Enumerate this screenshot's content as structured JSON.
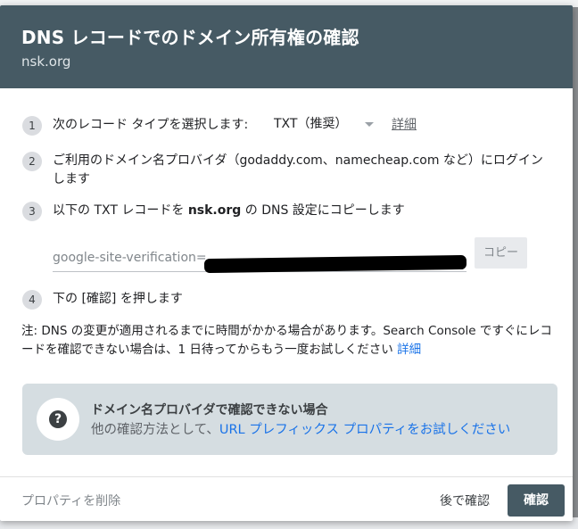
{
  "dialog": {
    "title": "DNS レコードでのドメイン所有権の確認",
    "subtitle": "nsk.org"
  },
  "steps": [
    {
      "number": "1",
      "text": "次のレコード タイプを選択します:"
    },
    {
      "number": "2",
      "text_line1": "ご利用のドメイン名プロバイダ（godaddy.com、namecheap.com など）にログイン",
      "text_line2": "します"
    },
    {
      "number": "3",
      "text_before": "以下の TXT レコードを ",
      "domain": "nsk.org",
      "text_after": " の DNS 設定にコピーします"
    },
    {
      "number": "4",
      "text": "下の [確認] を押します"
    }
  ],
  "record_type": {
    "selected": "TXT（推奨）",
    "details_link": "詳細"
  },
  "txt_record": {
    "value_prefix": "google-site-verification=",
    "copy_label": "コピー"
  },
  "note": {
    "text": "注: DNS の変更が適用されるまでに時間がかかる場合があります。Search Console ですぐにレコードを確認できない場合は、1 日待ってからもう一度お試しください",
    "link": "詳細"
  },
  "info": {
    "title": "ドメイン名プロバイダで確認できない場合",
    "body_prefix": "他の確認方法として、",
    "body_link": "URL プレフィックス プロパティをお試しください"
  },
  "footer": {
    "delete_label": "プロパティを削除",
    "later_label": "後で確認",
    "verify_label": "確認"
  },
  "colors": {
    "header_bg": "#465a64",
    "link": "#1a73e8",
    "info_bg": "#d5dde1"
  },
  "icons": {
    "help": "question-mark-circle",
    "dropdown": "chevron-down"
  }
}
